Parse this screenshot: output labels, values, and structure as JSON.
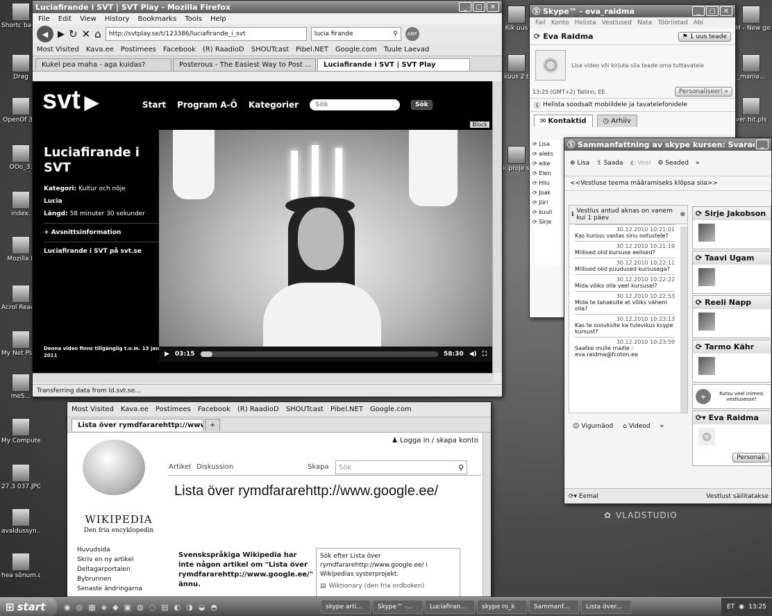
{
  "desktop": {
    "left_icons": [
      "Shortc backg",
      "Drag",
      "OpenOf 3.0",
      "OOo_3.",
      "index.",
      "Mozilla F",
      "Acrol Reader",
      "My Net Place",
      "meS...",
      "My Computer",
      "27.3 037.JPG",
      "avaldussyn...",
      "hea sõnum.odt"
    ],
    "left_icons2": [
      "Kik uus",
      "kuus 2 t",
      "Kik proje sisatud f"
    ],
    "right_icons": [
      "FM - New ge.pls",
      "_mania...",
      "ver hit.pls"
    ],
    "watermark": "VLADSTUDIO"
  },
  "firefox": {
    "title": "Luciafirande i SVT | SVT Play - Mozilla Firefox",
    "menu": [
      "File",
      "Edit",
      "View",
      "History",
      "Bookmarks",
      "Tools",
      "Help"
    ],
    "url": "http://svtplay.se/t/123386/luciafirande_i_svt",
    "search": "lucia firande",
    "bookmarks": [
      "Most Visited",
      "Kava.ee",
      "Postimees",
      "Facebook",
      "(R) RaadioD",
      "SHOUTcast",
      "Pibel.NET",
      "Google.com",
      "Tuule Laevad"
    ],
    "tabs": [
      "Kukel pea maha - aga kuidas?",
      "Posterous - The Easiest Way to Post ...",
      "Luciafirande i SVT | SVT Play"
    ],
    "status": "Transferring data from ld.svt.se..."
  },
  "svt": {
    "logo": "svt",
    "nav": [
      "Start",
      "Program A-Ö",
      "Kategorier"
    ],
    "search_placeholder": "Sök",
    "search_button": "Sök",
    "block": "Block",
    "title": "Luciafirande i SVT",
    "cat_label": "Kategori:",
    "cat_value": "Kultur och nöje",
    "series": "Lucia",
    "length_label": "Längd:",
    "length_value": "58 minuter 30 sekunder",
    "episode_info": "Avsnittsinformation",
    "link": "Luciafirande i SVT på svt.se",
    "avail": "Denna video finns tillgänglig t.o.m. 13 jan 2011",
    "time_current": "03:15",
    "time_total": "58:30",
    "progress": 0.05
  },
  "firefox2": {
    "bookmarks": [
      "Most Visited",
      "Kava.ee",
      "Postimees",
      "Facebook",
      "(R) RaadioD",
      "SHOUTcast",
      "Pibel.NET",
      "Google.com"
    ],
    "tab": "Lista över rymdfararehttp://www.go..."
  },
  "wiki": {
    "login": "Logga in / skapa konto",
    "wordmark": "WIKIPEDIA",
    "tagline": "Den fria encyklopedin",
    "tabs": [
      "Artikel",
      "Diskussion"
    ],
    "create": "Skapa",
    "search_placeholder": "Sök",
    "title": "Lista över rymdfararehttp://www.google.ee/",
    "nav": [
      "Huvudsida",
      "Skriv en ny artikel",
      "Deltagarportalen",
      "Bybrunnen",
      "Senaste ändringarna"
    ],
    "notice": "Svenskspråkiga Wikipedia har inte någon artikel om \"Lista över rymdfararehttp://www.google.ee/\" ännu.",
    "box_text": "Sök efter Lista över rymdfararehttp://www.google.ee/ i Wikipedias systerprojekt:",
    "box_item": "Wiktionary (den fria ordboken)"
  },
  "skype": {
    "title": "Skype™ - eva_raidma",
    "menu": [
      "Fail",
      "Konto",
      "Helista",
      "Vestlused",
      "Nata",
      "Tööriistad",
      "Abi"
    ],
    "user": "Eva Raidma",
    "new_msg": "1 uus teade",
    "mood_prompt": "Lisa video või kirjuta siia teade oma tuttavatele",
    "time": "13:25 (GMT+2) Tallinn, EE",
    "personalize": "Personaliseeri »",
    "promo": "Helista soodsalt mobiildele ja tavatelefonidele",
    "tab_contacts": "Kontaktid",
    "tab_history": "Arhiiv",
    "contacts": [
      "Lisa",
      "aleks",
      "eike",
      "Elen",
      "Hiiu",
      "Joak",
      "Jüri",
      "kuuli",
      "Sirje"
    ]
  },
  "chat": {
    "title": "Sammanfattning av skype kursen: Svarade k...",
    "toolbar": [
      "Lisa",
      "Saada",
      "Veel",
      "Seaded"
    ],
    "topic": "<<Vestluse teema määramiseks klõpsa siia>>",
    "notice": "Vestlus antud aknas on vanem kui 1 päev",
    "messages": [
      {
        "time": "30.12.2010 10:21:01",
        "text": "Kas kursus vastas sinu ootustele?"
      },
      {
        "time": "30.12.2010 10:21:19",
        "text": "Millised olid kursuse eelised?"
      },
      {
        "time": "30.12.2010 10:22:11",
        "text": "Millised olid puudused kursusega?"
      },
      {
        "time": "30.12.2010 10:22:22",
        "text": "Mida võiks olla veel kursusel?"
      },
      {
        "time": "30.12.2010 10:22:53",
        "text": "Mida te tahaksite et võiks vähem olla?"
      },
      {
        "time": "30.12.2010 10:23:13",
        "text": "Kas te soovksite ka tulevikus ksype kursust?"
      },
      {
        "time": "30.12.2010 10:23:59",
        "text": "Saatke mulle maille : eva.raidma@fcoton.ee"
      }
    ],
    "bottom": [
      "Vigurnäod",
      "Videod"
    ],
    "participants": [
      "Sirje Jakobson",
      "Taavi Ugam",
      "Reeli Napp",
      "Tarmo Kähr"
    ],
    "invite": "Kutsu veel inimesi vestlusesse!",
    "self": "Eva Raidma",
    "personalize": "Personali",
    "footer_left": "Eemal",
    "footer_right": "Vestlust säilitatakse"
  },
  "taskbar": {
    "start": "start",
    "tasks": [
      "skype arti...",
      "Skype™ -...",
      "Luciafiran...",
      "skype ro_k",
      "Sammanf...",
      "Lista över..."
    ],
    "lang": "ET",
    "clock": "13:25"
  }
}
